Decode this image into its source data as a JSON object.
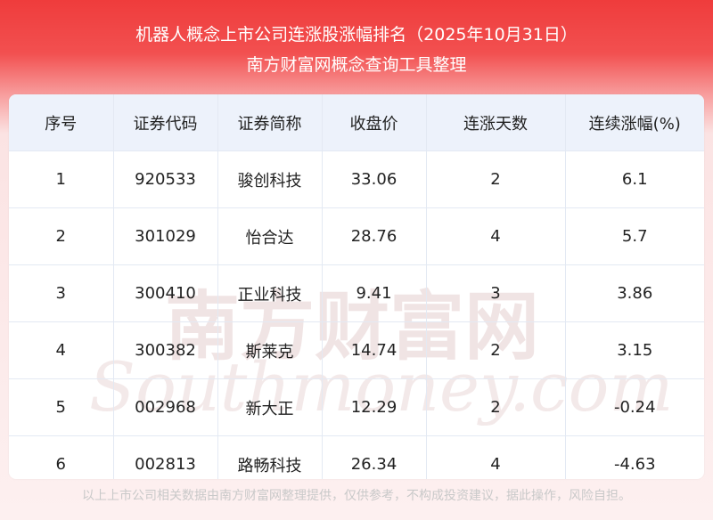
{
  "header": {
    "title": "机器人概念上市公司连涨股涨幅排名（2025年10月31日）",
    "subtitle": "南方财富网概念查询工具整理"
  },
  "table": {
    "columns": [
      "序号",
      "证券代码",
      "证券简称",
      "收盘价",
      "连涨天数",
      "连续涨幅(%)"
    ],
    "rows": [
      [
        "1",
        "920533",
        "骏创科技",
        "33.06",
        "2",
        "6.1"
      ],
      [
        "2",
        "301029",
        "怡合达",
        "28.76",
        "4",
        "5.7"
      ],
      [
        "3",
        "300410",
        "正业科技",
        "9.41",
        "3",
        "3.86"
      ],
      [
        "4",
        "300382",
        "斯莱克",
        "14.74",
        "2",
        "3.15"
      ],
      [
        "5",
        "002968",
        "新大正",
        "12.29",
        "2",
        "-0.24"
      ],
      [
        "6",
        "002813",
        "路畅科技",
        "26.34",
        "4",
        "-4.63"
      ]
    ]
  },
  "watermark": {
    "cn": "南方财富网",
    "en": "Southmoney.com"
  },
  "footer": {
    "disclaimer": "以上上市公司相关数据由南方财富网整理提供，仅供参考，不构成投资建议，据此操作，风险自担。"
  },
  "colors": {
    "header_red": "#ef3c3c",
    "table_header_bg": "#edf2fb",
    "grid_line": "#e3e9f3",
    "watermark": "#e9dede"
  }
}
